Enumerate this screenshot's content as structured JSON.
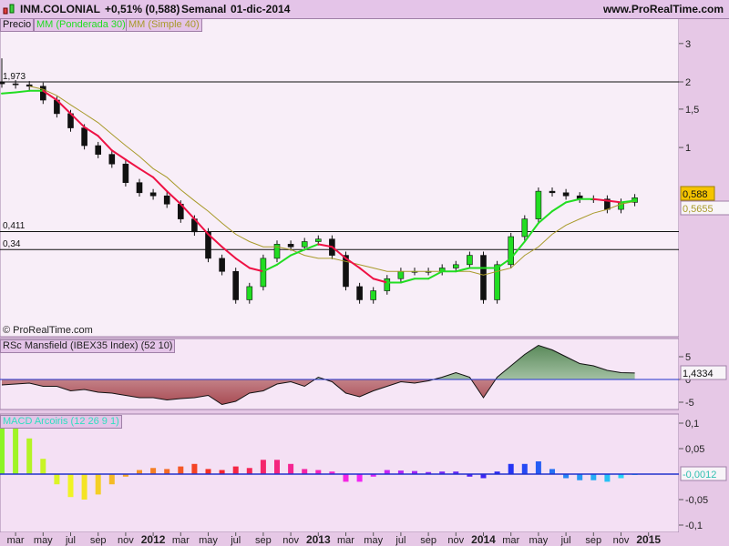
{
  "header": {
    "symbol": "INM.COLONIAL",
    "change": "+0,51% (0,588)",
    "period": "Semanal",
    "date": "01-dic-2014",
    "site": "www.ProRealTime.com"
  },
  "price_panel": {
    "legend": {
      "price": "Precio",
      "ma30": "MM (Ponderada 30)",
      "ma40": "MM (Simple 40)"
    },
    "copyright": "© ProRealTime.com",
    "levels": [
      {
        "label": "1,973",
        "value": 1.973
      },
      {
        "label": "0,411",
        "value": 0.411
      },
      {
        "label": "0,34",
        "value": 0.34
      }
    ],
    "horizontal_lines": [
      2,
      0.411,
      0.34
    ],
    "last_price_label": "0,588",
    "ma40_label": "0,5655",
    "y_ticks": [
      {
        "label": "3",
        "value": 3
      },
      {
        "label": "2",
        "value": 2
      },
      {
        "label": "1,5",
        "value": 1.5
      },
      {
        "label": "1",
        "value": 1
      }
    ],
    "scale": "log"
  },
  "rsc_panel": {
    "title": "RSc Mansfield (IBEX35 Index) (52 10)",
    "last_label": "1,4334",
    "y_ticks": [
      {
        "label": "5",
        "value": 5
      },
      {
        "label": "0",
        "value": 0
      },
      {
        "label": "-5",
        "value": -5
      }
    ]
  },
  "macd_panel": {
    "title": "MACD Arcoiris (12 26 9 1)",
    "last_label": "-0,0012",
    "y_ticks": [
      {
        "label": "0,1",
        "value": 0.1
      },
      {
        "label": "0,05",
        "value": 0.05
      },
      {
        "label": "-0,05",
        "value": -0.05
      },
      {
        "label": "-0,1",
        "value": -0.1
      }
    ]
  },
  "x_axis": {
    "ticks": [
      {
        "label": "mar",
        "date": "2011-03"
      },
      {
        "label": "may",
        "date": "2011-05"
      },
      {
        "label": "jul",
        "date": "2011-07"
      },
      {
        "label": "sep",
        "date": "2011-09"
      },
      {
        "label": "nov",
        "date": "2011-11"
      },
      {
        "label": "2012",
        "date": "2012-01",
        "bold": true
      },
      {
        "label": "mar",
        "date": "2012-03"
      },
      {
        "label": "may",
        "date": "2012-05"
      },
      {
        "label": "jul",
        "date": "2012-07"
      },
      {
        "label": "sep",
        "date": "2012-09"
      },
      {
        "label": "nov",
        "date": "2012-11"
      },
      {
        "label": "2013",
        "date": "2013-01",
        "bold": true
      },
      {
        "label": "mar",
        "date": "2013-03"
      },
      {
        "label": "may",
        "date": "2013-05"
      },
      {
        "label": "jul",
        "date": "2013-07"
      },
      {
        "label": "sep",
        "date": "2013-09"
      },
      {
        "label": "nov",
        "date": "2013-11"
      },
      {
        "label": "2014",
        "date": "2014-01",
        "bold": true
      },
      {
        "label": "mar",
        "date": "2014-03"
      },
      {
        "label": "may",
        "date": "2014-05"
      },
      {
        "label": "jul",
        "date": "2014-07"
      },
      {
        "label": "sep",
        "date": "2014-09"
      },
      {
        "label": "nov",
        "date": "2014-11"
      },
      {
        "label": "2015",
        "date": "2015-01",
        "bold": true
      }
    ]
  },
  "colors": {
    "ma_up": "#22dd22",
    "ma_down": "#ee1144",
    "ma40": "#a89a2a",
    "zero_line": "#2233cc",
    "last_price_bg": "#f5c400",
    "rsc_fill_pos": "#6a9a6a",
    "rsc_fill_neg": "#a84c54"
  },
  "chart_data": {
    "type": "candlestick",
    "start": "2011-02",
    "interval": "month",
    "close": [
      1.96,
      1.94,
      1.91,
      1.65,
      1.43,
      1.23,
      1.02,
      0.93,
      0.84,
      0.69,
      0.62,
      0.6,
      0.55,
      0.47,
      0.41,
      0.31,
      0.27,
      0.2,
      0.23,
      0.31,
      0.36,
      0.35,
      0.37,
      0.38,
      0.32,
      0.23,
      0.2,
      0.22,
      0.25,
      0.27,
      0.27,
      0.27,
      0.28,
      0.29,
      0.32,
      0.2,
      0.29,
      0.39,
      0.47,
      0.63,
      0.62,
      0.6,
      0.58,
      0.58,
      0.52,
      0.56,
      0.588
    ],
    "ma30_weighted": [
      1.77,
      1.79,
      1.82,
      1.82,
      1.65,
      1.43,
      1.24,
      1.13,
      0.97,
      0.88,
      0.8,
      0.73,
      0.63,
      0.55,
      0.47,
      0.4,
      0.35,
      0.31,
      0.28,
      0.27,
      0.29,
      0.32,
      0.34,
      0.36,
      0.35,
      0.31,
      0.28,
      0.25,
      0.24,
      0.24,
      0.25,
      0.25,
      0.27,
      0.27,
      0.28,
      0.28,
      0.28,
      0.31,
      0.37,
      0.45,
      0.51,
      0.56,
      0.58,
      0.58,
      0.57,
      0.56,
      0.57
    ],
    "ma40_simple": [
      null,
      null,
      1.91,
      1.85,
      1.73,
      1.57,
      1.43,
      1.3,
      1.15,
      1.02,
      0.91,
      0.8,
      0.73,
      0.64,
      0.57,
      0.51,
      0.45,
      0.4,
      0.37,
      0.35,
      0.35,
      0.34,
      0.32,
      0.31,
      0.31,
      0.3,
      0.29,
      0.28,
      0.27,
      0.27,
      0.27,
      0.27,
      0.27,
      0.27,
      0.27,
      0.26,
      0.27,
      0.28,
      0.32,
      0.35,
      0.4,
      0.44,
      0.47,
      0.5,
      0.52,
      0.55,
      0.5655
    ],
    "rsc_mansfield": [
      -1.2,
      -1,
      -0.8,
      -1.5,
      -1.5,
      -2.5,
      -2.2,
      -2.8,
      -3,
      -3.5,
      -4,
      -4,
      -4.5,
      -4.2,
      -4,
      -3.5,
      -5.5,
      -4.8,
      -3,
      -2.5,
      -1,
      -0.5,
      -1.5,
      0.5,
      -0.5,
      -3,
      -3.8,
      -2.5,
      -1.5,
      -0.5,
      -0.8,
      -0.3,
      0.5,
      1.5,
      0.5,
      -4,
      0.5,
      3,
      5.5,
      7.5,
      6.5,
      5,
      3.5,
      3,
      2,
      1.5,
      1.4334
    ],
    "macd_histogram": [
      0.1,
      0.1,
      0.07,
      0.03,
      -0.02,
      -0.045,
      -0.05,
      -0.04,
      -0.02,
      -0.005,
      0.008,
      0.012,
      0.01,
      0.015,
      0.02,
      0.01,
      0.008,
      0.015,
      0.012,
      0.028,
      0.028,
      0.02,
      0.01,
      0.008,
      0.005,
      -0.015,
      -0.015,
      -0.005,
      0.008,
      0.007,
      0.006,
      0.004,
      0.005,
      0.005,
      -0.005,
      -0.008,
      0.005,
      0.02,
      0.02,
      0.025,
      0.01,
      -0.008,
      -0.012,
      -0.012,
      -0.015,
      -0.008,
      -0.0012
    ]
  }
}
